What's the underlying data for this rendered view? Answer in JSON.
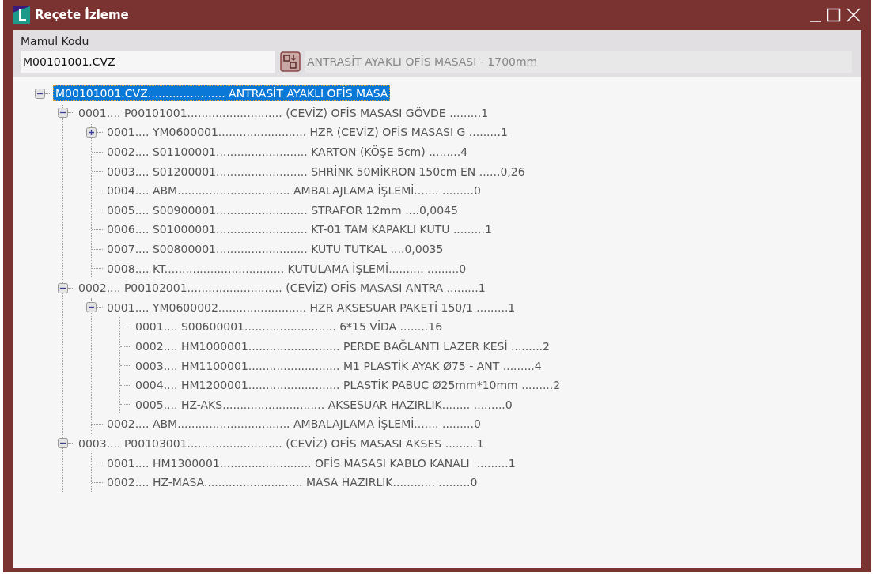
{
  "window": {
    "title": "Reçete İzleme"
  },
  "header": {
    "label": "Mamul Kodu",
    "code_field": {
      "value": "M00101001.CVZ"
    },
    "description_field": {
      "value": "ANTRASİT AYAKLI OFİS MASASI - 1700mm",
      "disabled": true
    }
  },
  "tree": [
    {
      "text": "M00101001.CVZ...................... ANTRASİT AYAKLI OFİS MASA",
      "selected": true,
      "expanded": true,
      "children": [
        {
          "text": "0001.... P00101001........................... (CEVİZ) OFİS MASASI GÖVDE .........1",
          "selected": false,
          "expanded": true,
          "children": [
            {
              "text": "0001.... YM0600001......................... HZR (CEVİZ) OFİS MASASI G .........1",
              "selected": false,
              "expanded": false
            },
            {
              "text": "0002.... S01100001.......................... KARTON (KÖŞE 5cm) .........4",
              "selected": false
            },
            {
              "text": "0003.... S01200001.......................... SHRİNK 50MİKRON 150cm EN ......0,26",
              "selected": false
            },
            {
              "text": "0004.... ABM................................ AMBALAJLAMA İŞLEMİ....... .........0",
              "selected": false
            },
            {
              "text": "0005.... S00900001.......................... STRAFOR 12mm ....0,0045",
              "selected": false
            },
            {
              "text": "0006.... S01000001.......................... KT-01 TAM KAPAKLI KUTU .........1",
              "selected": false
            },
            {
              "text": "0007.... S00800001.......................... KUTU TUTKAL ....0,0035",
              "selected": false
            },
            {
              "text": "0008.... KT.................................. KUTULAMA İŞLEMİ.......... .........0",
              "selected": false
            }
          ]
        },
        {
          "text": "0002.... P00102001........................... (CEVİZ) OFİS MASASI ANTRA .........1",
          "selected": false,
          "expanded": true,
          "children": [
            {
              "text": "0001.... YM0600002......................... HZR AKSESUAR PAKETİ 150/1 .........1",
              "selected": false,
              "expanded": true,
              "children": [
                {
                  "text": "0001.... S00600001.......................... 6*15 VİDA ........16",
                  "selected": false
                },
                {
                  "text": "0002.... HM1000001.......................... PERDE BAĞLANTI LAZER KESİ .........2",
                  "selected": false
                },
                {
                  "text": "0003.... HM1100001.......................... M1 PLASTİK AYAK Ø75 - ANT .........4",
                  "selected": false
                },
                {
                  "text": "0004.... HM1200001.......................... PLASTİK PABUÇ Ø25mm*10mm .........2",
                  "selected": false
                },
                {
                  "text": "0005.... HZ-AKS............................. AKSESUAR HAZIRLIK........ .........0",
                  "selected": false
                }
              ]
            },
            {
              "text": "0002.... ABM................................ AMBALAJLAMA İŞLEMİ....... .........0",
              "selected": false
            }
          ]
        },
        {
          "text": "0003.... P00103001........................... (CEVİZ) OFİS MASASI AKSES .........1",
          "selected": false,
          "expanded": true,
          "children": [
            {
              "text": "0001.... HM1300001.......................... OFİS MASASI KABLO KANALI  .........1",
              "selected": false
            },
            {
              "text": "0002.... HZ-MASA............................ MASA HAZIRLIK............ .........0",
              "selected": false
            }
          ]
        }
      ]
    }
  ]
}
